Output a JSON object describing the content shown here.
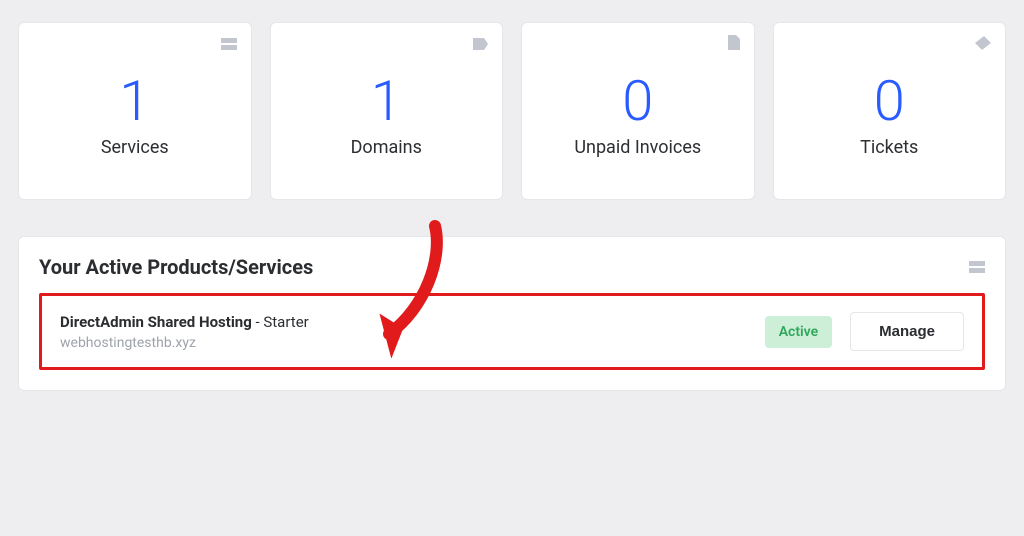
{
  "stats": [
    {
      "value": "1",
      "label": "Services",
      "icon": "server-icon"
    },
    {
      "value": "1",
      "label": "Domains",
      "icon": "tag-icon"
    },
    {
      "value": "0",
      "label": "Unpaid Invoices",
      "icon": "file-icon"
    },
    {
      "value": "0",
      "label": "Tickets",
      "icon": "ticket-icon"
    }
  ],
  "panel": {
    "title": "Your Active Products/Services",
    "icon": "server-icon"
  },
  "service": {
    "product": "DirectAdmin Shared Hosting",
    "plan": "Starter",
    "domain": "webhostingtesthb.xyz",
    "status": "Active",
    "manage_label": "Manage"
  },
  "annotation": {
    "type": "arrow",
    "color": "#e11b1b"
  }
}
